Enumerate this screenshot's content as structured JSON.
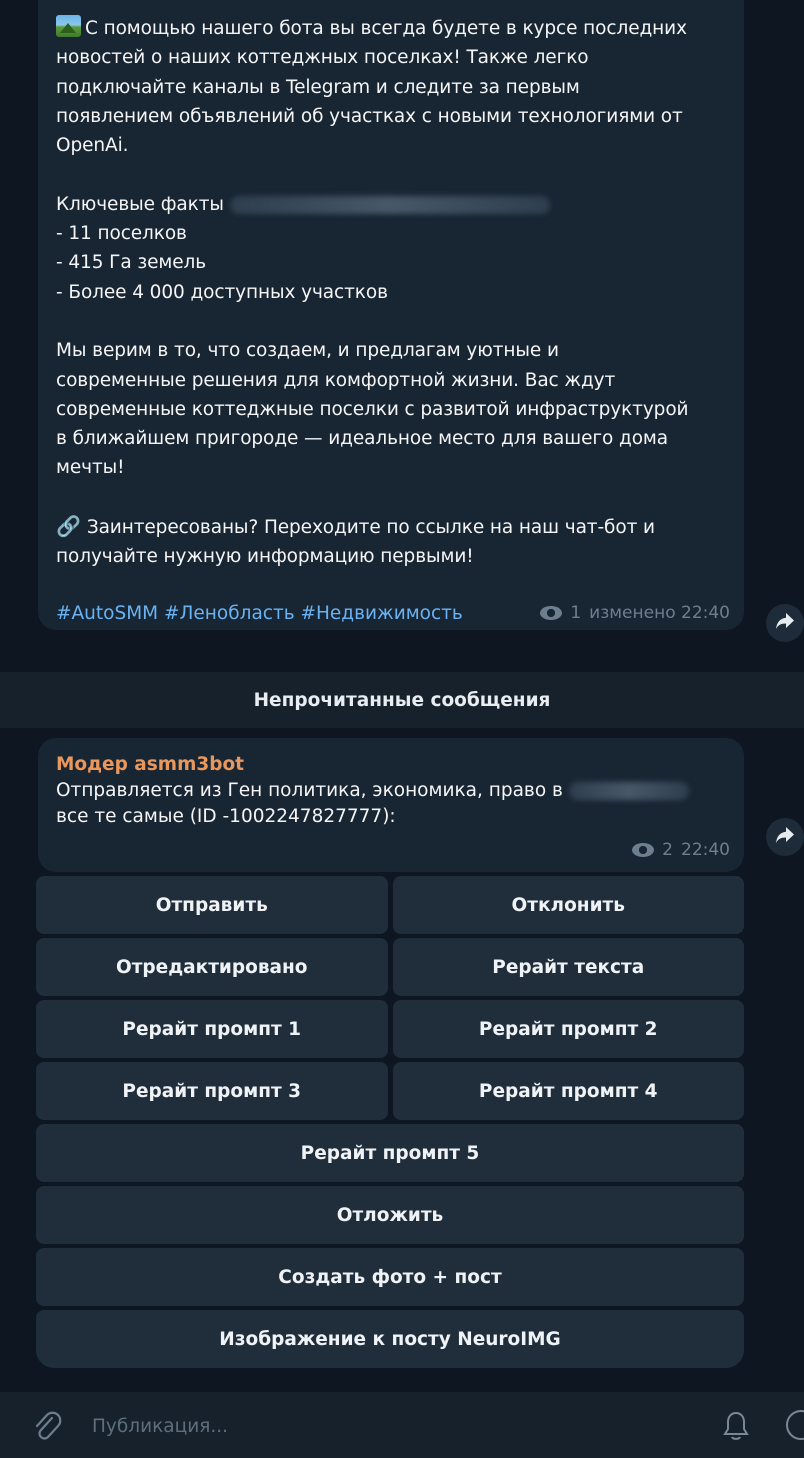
{
  "post": {
    "line1": "С помощью нашего бота вы всегда будете в курсе последних\nновостей о наших коттеджных поселках! Также легко\nподключайте каналы в Telegram и следите за первым\nпоявлением объявлений об участках с новыми технологиями от\nOpenAi.",
    "facts_label": "Ключевые факты",
    "facts": "- 11 поселков\n- 415 Га земель\n- Более 4 000 доступных участков",
    "para2": "Мы верим в то, что создаем, и предлагам уютные и\nсовременные решения для комфортной жизни. Вас ждут\nсовременные коттеджные поселки с развитой инфраструктурой\nв ближайшем пригороде — идеальное место для вашего дома\nмечты!",
    "cta_icon": "🔗",
    "cta": "Заинтересованы? Переходите по ссылке на наш чат-бот и\nполучайте нужную информацию первыми!",
    "hashtags": "#AutoSMM #Ленобласть #Недвижимость",
    "views": "1",
    "edited_time": "изменено 22:40"
  },
  "unread_bar": "Непрочитанные сообщения",
  "bot_message": {
    "sender": "Модер asmm3bot",
    "text_before": "Отправляется из Ген политика, экономика, право в",
    "text_after": "все те самые (ID -1002247827777):",
    "views": "2",
    "time": "22:40"
  },
  "keyboard": [
    [
      "Отправить",
      "Отклонить"
    ],
    [
      "Отредактировано",
      "Рерайт текста"
    ],
    [
      "Рерайт промпт 1",
      "Рерайт промпт 2"
    ],
    [
      "Рерайт промпт 3",
      "Рерайт промпт 4"
    ],
    [
      "Рерайт промпт 5"
    ],
    [
      "Отложить"
    ],
    [
      "Создать фото + пост"
    ],
    [
      "Изображение к посту NeuroIMG"
    ]
  ],
  "composer": {
    "placeholder": "Публикация..."
  },
  "colors": {
    "background": "#0e1621",
    "bubble": "#182533",
    "button": "#202e3c",
    "link": "#6ab3f3",
    "sender": "#e9975b",
    "meta": "#6d7f8f"
  }
}
